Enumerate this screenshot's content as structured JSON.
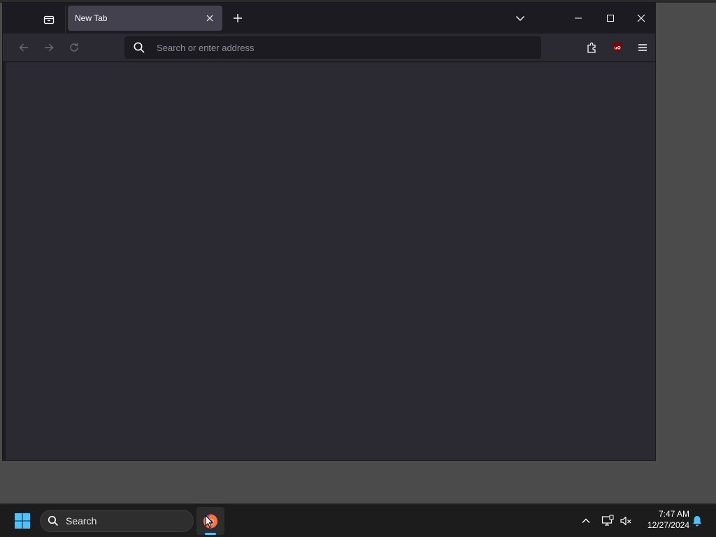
{
  "browser": {
    "tabs": [
      {
        "label": "New Tab"
      }
    ],
    "urlbar": {
      "placeholder": "Search or enter address",
      "value": ""
    },
    "colors": {
      "titlebar": "#1c1b22",
      "toolbar": "#2b2a33",
      "tab_active": "#42414d",
      "ublock_red": "#800000"
    },
    "toolbar_icons": [
      "back-arrow-icon",
      "forward-arrow-icon",
      "reload-icon",
      "search-icon",
      "puzzle-extensions-icon",
      "ublock-origin-icon",
      "hamburger-menu-icon"
    ]
  },
  "taskbar": {
    "search_label": "Search",
    "apps": [
      {
        "name": "Firefox",
        "icon": "firefox-icon",
        "running": true
      }
    ],
    "clock": {
      "time": "7:47 AM",
      "date": "12/27/2024"
    },
    "tray_icons": [
      "chevron-up-icon",
      "network-icon",
      "volume-muted-icon",
      "notification-bell-icon"
    ],
    "colors": {
      "start_blue": "#4cc2ff",
      "running_indicator": "#4cc2ff"
    }
  }
}
